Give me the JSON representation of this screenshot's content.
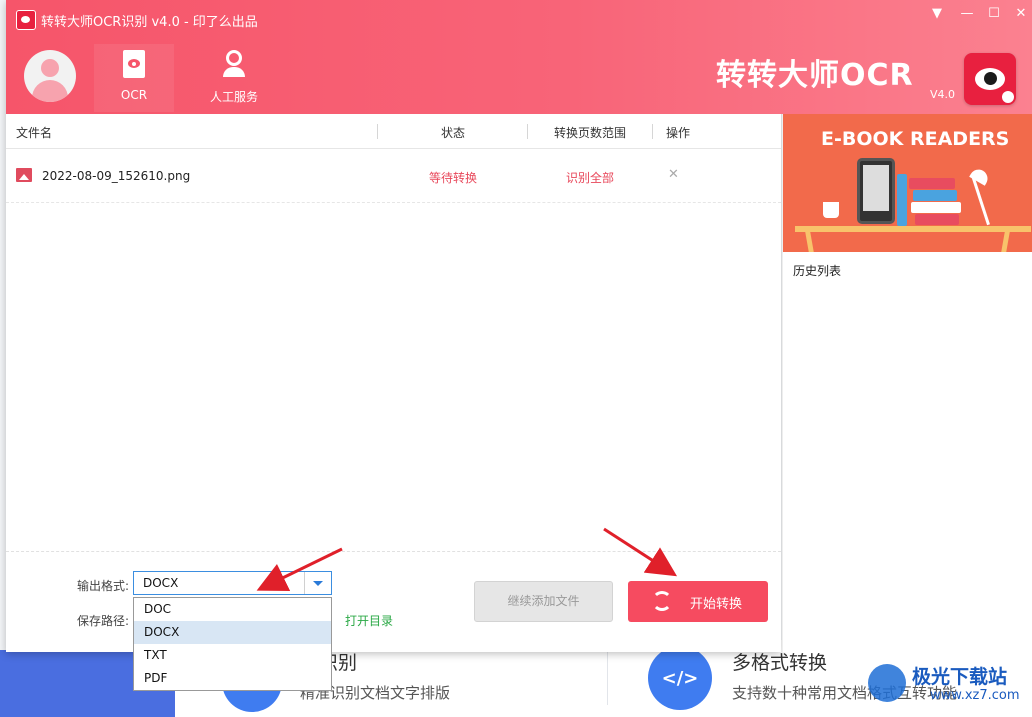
{
  "window": {
    "title": "转转大师OCR识别 v4.0 - 印了么出品",
    "controls": [
      "▼",
      "—",
      "☐",
      "✕"
    ]
  },
  "nav": {
    "items": [
      {
        "label": "OCR",
        "icon": "ocr-document-icon"
      },
      {
        "label": "人工服务",
        "icon": "customer-service-icon"
      }
    ]
  },
  "brand": {
    "name": "转转大师OCR",
    "version": "V4.0"
  },
  "table": {
    "headers": [
      "文件名",
      "状态",
      "转换页数范围",
      "操作"
    ],
    "rows": [
      {
        "file": "2022-08-09_152610.png",
        "status": "等待转换",
        "range": "识别全部",
        "action": "✕"
      }
    ]
  },
  "sidebar": {
    "banner_text": "E-BOOK READERS",
    "history_label": "历史列表"
  },
  "output": {
    "format_label": "输出格式:",
    "format_value": "DOCX",
    "format_options": [
      "DOC",
      "DOCX",
      "TXT",
      "PDF"
    ],
    "selected_option": "DOCX",
    "path_label": "保存路径:",
    "open_dir_label": "打开目录"
  },
  "buttons": {
    "add_files": "继续添加文件",
    "start": "开始转换"
  },
  "background": {
    "feature1_title": "准识别",
    "feature1_desc": "精准识别文档文字排版",
    "feature2_title": "多格式转换",
    "feature2_desc": "支持数十种常用文档格式互转功能",
    "feature2_icon_text": "</>"
  },
  "watermark": {
    "title": "极光下载站",
    "url": "www.xz7.com"
  },
  "colors": {
    "accent": "#f64b60",
    "header": "#f6556a",
    "link": "#2aa845",
    "status": "#e8475a",
    "annotation_arrow": "#e0202a"
  }
}
